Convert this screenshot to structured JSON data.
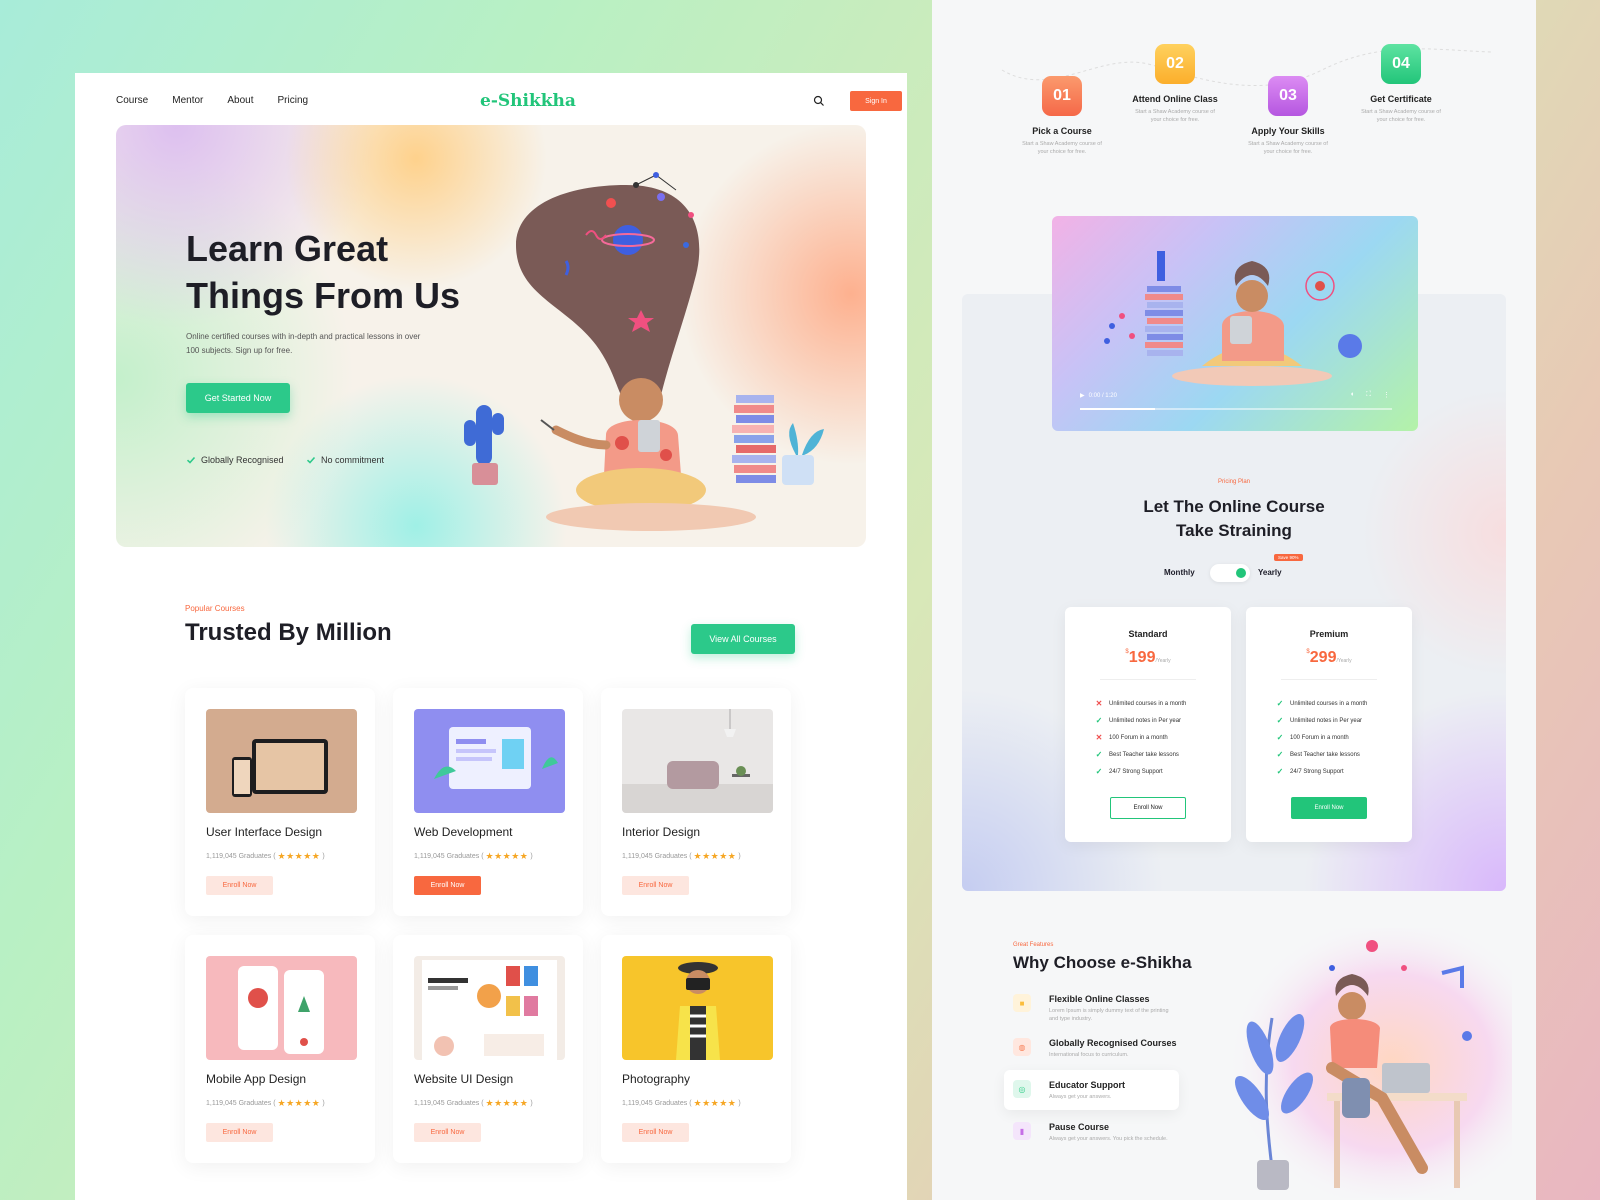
{
  "nav": {
    "links": [
      "Course",
      "Mentor",
      "About",
      "Pricing"
    ],
    "logo": "e-Shikkha",
    "signin": "Sign In"
  },
  "hero": {
    "title_line1": "Learn Great",
    "title_line2": "Things From Us",
    "subtitle": "Online certified courses with in-depth and practical lessons in over 100 subjects. Sign up for free.",
    "cta": "Get Started Now",
    "checks": [
      "Globally Recognised",
      "No commitment"
    ]
  },
  "courses": {
    "eyebrow": "Popular Courses",
    "title": "Trusted By Million",
    "view_all": "View All Courses",
    "items": [
      {
        "title": "User Interface Design",
        "graduates": "1,119,045 Graduates (",
        "close": ")",
        "btn": "Enroll Now",
        "active": false
      },
      {
        "title": "Web Development",
        "graduates": "1,119,045 Graduates (",
        "close": ")",
        "btn": "Enroll Now",
        "active": true
      },
      {
        "title": "Interior Design",
        "graduates": "1,119,045 Graduates (",
        "close": ")",
        "btn": "Enroll Now",
        "active": false
      },
      {
        "title": "Mobile App Design",
        "graduates": "1,119,045 Graduates (",
        "close": ")",
        "btn": "Enroll Now",
        "active": false
      },
      {
        "title": "Website UI Design",
        "graduates": "1,119,045 Graduates (",
        "close": ")",
        "btn": "Enroll Now",
        "active": false
      },
      {
        "title": "Photography",
        "graduates": "1,119,045 Graduates (",
        "close": ")",
        "btn": "Enroll Now",
        "active": false
      }
    ],
    "stars": "★★★★★"
  },
  "steps": [
    {
      "num": "01",
      "title": "Pick a Course",
      "desc": "Start a Shaw Academy course of your choice for free.",
      "color": "#f8825a"
    },
    {
      "num": "02",
      "title": "Attend Online Class",
      "desc": "Start a Shaw Academy course of your choice for free.",
      "color": "#fbbd3c"
    },
    {
      "num": "03",
      "title": "Apply Your Skills",
      "desc": "Start a Shaw Academy course of your choice for free.",
      "color": "#c56ee6"
    },
    {
      "num": "04",
      "title": "Get Certificate",
      "desc": "Start a Shaw Academy course of your choice for free.",
      "color": "#35cf8b"
    }
  ],
  "video": {
    "time": "0:00 / 1:20"
  },
  "pricing": {
    "eyebrow": "Pricing Plan",
    "title_line1": "Let The Online Course",
    "title_line2": "Take Straining",
    "monthly": "Monthly",
    "yearly": "Yearly",
    "save": "Save 90%",
    "plans": [
      {
        "name": "Standard",
        "currency": "$",
        "price": "199",
        "period": "/Yearly",
        "features": [
          {
            "text": "Unlimited courses in a month",
            "ok": false
          },
          {
            "text": "Unlimited notes in Per year",
            "ok": true
          },
          {
            "text": "100 Forum in a month",
            "ok": false
          },
          {
            "text": "Best Teacher take lessons",
            "ok": true
          },
          {
            "text": "24/7 Strong Support",
            "ok": true
          }
        ],
        "btn": "Enroll Now",
        "filled": false
      },
      {
        "name": "Premium",
        "currency": "$",
        "price": "299",
        "period": "/Yearly",
        "features": [
          {
            "text": "Unlimited courses in a month",
            "ok": true
          },
          {
            "text": "Unlimited notes in Per year",
            "ok": true
          },
          {
            "text": "100 Forum in a month",
            "ok": true
          },
          {
            "text": "Best Teacher take lessons",
            "ok": true
          },
          {
            "text": "24/7 Strong Support",
            "ok": true
          }
        ],
        "btn": "Enroll Now",
        "filled": true
      }
    ]
  },
  "why": {
    "eyebrow": "Great Features",
    "title": "Why Choose e-Shikha",
    "items": [
      {
        "title": "Flexible Online Classes",
        "desc": "Lorem Ipsum is simply dummy text of the printing and type industry.",
        "color": "#fbbd3c"
      },
      {
        "title": "Globally Recognised Courses",
        "desc": "International focus to curriculum.",
        "color": "#f8825a"
      },
      {
        "title": "Educator Support",
        "desc": "Always get your answers.",
        "color": "#35cf8b"
      },
      {
        "title": "Pause Course",
        "desc": "Always get your answers. You pick the schedule.",
        "color": "#c56ee6"
      }
    ]
  },
  "colors": {
    "accent": "#f8683f",
    "green": "#2cc98a"
  }
}
